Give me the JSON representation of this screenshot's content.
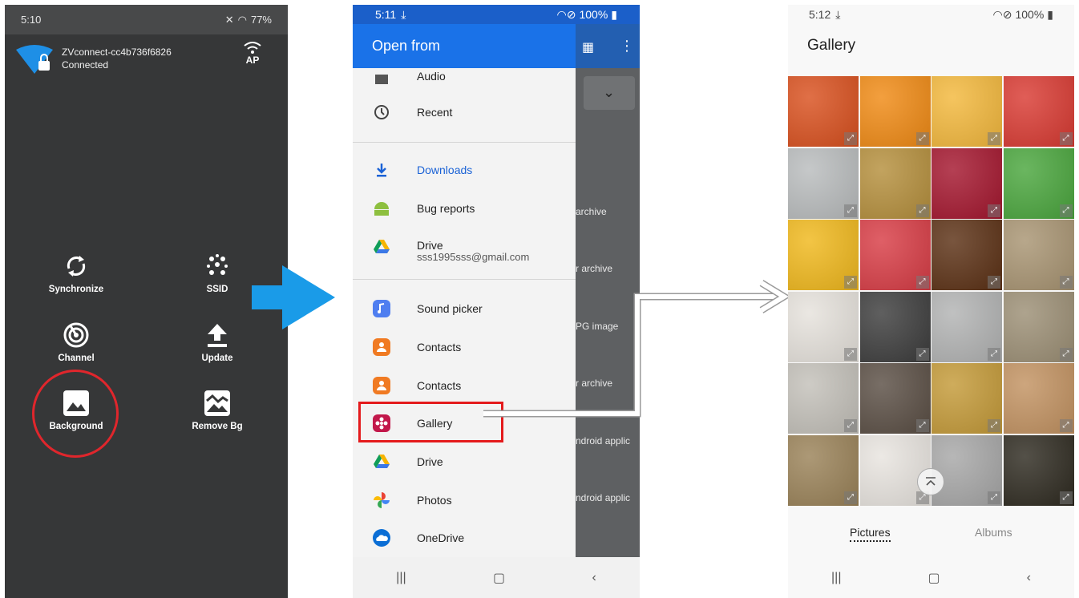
{
  "panel1": {
    "status_time": "5:10",
    "status_battery": "77%",
    "network_name": "ZVconnect-cc4b736f6826",
    "network_status": "Connected",
    "mode_label": "AP",
    "actions": [
      {
        "label": "Synchronize",
        "icon": "sync-icon"
      },
      {
        "label": "SSID",
        "icon": "ssid-dots-icon"
      },
      {
        "label": "Channel",
        "icon": "channel-icon"
      },
      {
        "label": "Update",
        "icon": "upload-icon"
      },
      {
        "label": "Background",
        "icon": "image-icon"
      },
      {
        "label": "Remove Bg",
        "icon": "remove-bg-icon"
      }
    ],
    "highlight_color": "#e0262c"
  },
  "panel2": {
    "status_time": "5:11",
    "status_battery": "100%",
    "drawer_title": "Open from",
    "items": [
      {
        "label": "Audio",
        "icon": "audio-icon"
      },
      {
        "label": "Recent",
        "icon": "clock-icon"
      },
      {
        "label": "Downloads",
        "icon": "download-icon"
      },
      {
        "label": "Bug reports",
        "icon": "android-icon"
      },
      {
        "label": "Drive",
        "icon": "drive-icon",
        "sub": "sss1995sss@gmail.com"
      },
      {
        "label": "Sound picker",
        "icon": "music-icon"
      },
      {
        "label": "Contacts",
        "icon": "contacts-icon"
      },
      {
        "label": "Contacts",
        "icon": "contacts-icon"
      },
      {
        "label": "Gallery",
        "icon": "gallery-icon"
      },
      {
        "label": "Drive",
        "icon": "drive-icon"
      },
      {
        "label": "Photos",
        "icon": "photos-icon"
      },
      {
        "label": "OneDrive",
        "icon": "onedrive-icon"
      }
    ],
    "behind_texts": [
      "archive",
      "r archive",
      "PG image",
      "r archive",
      "ndroid applic",
      "ndroid applic"
    ],
    "accent_color": "#1a72e8",
    "highlight_color": "#e41a1c"
  },
  "panel3": {
    "status_time": "5:12",
    "status_battery": "100%",
    "title": "Gallery",
    "tab_pictures": "Pictures",
    "tab_albums": "Albums",
    "tiles": [
      "#d9501e",
      "#f08a14",
      "#f3b83c",
      "#d93a32",
      "#b9bcbd",
      "#b58f3c",
      "#a4162e",
      "#4aa63d",
      "#f0b81c",
      "#d83c45",
      "#5b3014",
      "#a89472",
      "#e6e2dc",
      "#3c3c3c",
      "#b2b3b3",
      "#9c8f75",
      "#c3c0b9",
      "#5a4e44",
      "#c49a38",
      "#c29261",
      "#9a8258",
      "#e8e4df",
      "#a7a7a7",
      "#2e2a20"
    ]
  }
}
